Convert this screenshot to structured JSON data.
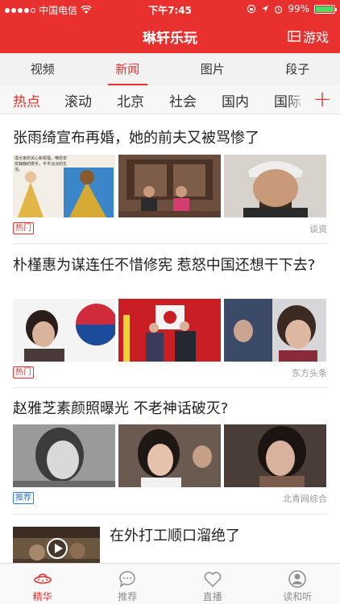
{
  "status": {
    "carrier": "中国电信",
    "time": "下午7:45",
    "battery": "99%",
    "battery_level": 0.99
  },
  "titlebar": {
    "title": "琳轩乐玩",
    "game_label": "游戏"
  },
  "primary_tabs": [
    {
      "label": "视频",
      "active": false
    },
    {
      "label": "新闻",
      "active": true
    },
    {
      "label": "图片",
      "active": false
    },
    {
      "label": "段子",
      "active": false
    }
  ],
  "channels": [
    {
      "label": "热点",
      "active": true
    },
    {
      "label": "滚动",
      "active": false
    },
    {
      "label": "北京",
      "active": false
    },
    {
      "label": "社会",
      "active": false
    },
    {
      "label": "国内",
      "active": false
    },
    {
      "label": "国际",
      "active": false
    }
  ],
  "articles": [
    {
      "headline": "张雨绮宣布再婚，她的前夫又被骂惨了",
      "badge": "热门",
      "badge_type": "hot",
      "source": "谈资",
      "thumb_caption": "漠大家的关心和祝福，唯愿安安静静的携手，平平淡淡的生活。"
    },
    {
      "headline": "朴槿惠为谋连任不惜修宪 惹怒中国还想干下去?",
      "badge": "热门",
      "badge_type": "hot",
      "source": "东方头条"
    },
    {
      "headline": "赵雅芝素颜照曝光 不老神话破灭?",
      "badge": "推荐",
      "badge_type": "rec",
      "source": "北青网综合"
    },
    {
      "headline": "在外打工顺口溜绝了"
    }
  ],
  "tabbar": [
    {
      "label": "精华",
      "icon": "ufo-icon",
      "active": true
    },
    {
      "label": "推荐",
      "icon": "chat-bubble-icon",
      "active": false
    },
    {
      "label": "直播",
      "icon": "heart-icon",
      "active": false
    },
    {
      "label": "读和听",
      "icon": "person-icon",
      "active": false
    }
  ],
  "colors": {
    "brand_red": "#e8302f",
    "recommend_blue": "#2b7bd8",
    "battery_green": "#4cd964"
  }
}
